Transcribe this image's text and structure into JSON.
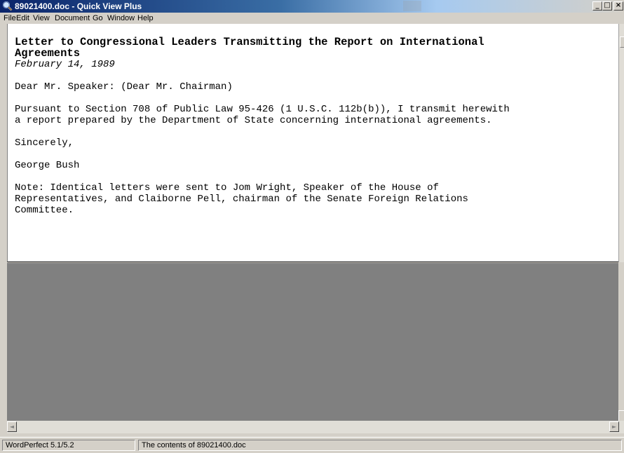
{
  "window": {
    "title": "89021400.doc - Quick View Plus",
    "app_icon": "magnifier-icon",
    "controls": {
      "minimize": "_",
      "maximize": "□",
      "close": "×"
    }
  },
  "menu": {
    "items": [
      "File",
      "Edit",
      "View",
      "Document",
      "Go",
      "Window",
      "Help"
    ]
  },
  "document": {
    "title_line1": "Letter to Congressional Leaders Transmitting the Report on International",
    "title_line2": "Agreements",
    "date": "February 14, 1989",
    "salutation": "Dear Mr. Speaker: (Dear Mr. Chairman)",
    "body_line1": "Pursuant to Section 708 of Public Law 95-426 (1 U.S.C. 112b(b)), I transmit herewith",
    "body_line2": "a report prepared by the Department of State concerning international agreements.",
    "closing": "Sincerely,",
    "signature": "George Bush",
    "note_line1": "Note: Identical letters were sent to Jom Wright, Speaker of the House of",
    "note_line2": "Representatives, and Claiborne Pell, chairman of the Senate Foreign Relations",
    "note_line3": "Committee."
  },
  "scrollbar": {
    "left_arrow": "◄",
    "right_arrow": "►"
  },
  "status": {
    "format": "WordPerfect 5.1/5.2",
    "message": "The contents of 89021400.doc"
  },
  "colors": {
    "titlebar_active": "#0a246a",
    "workspace": "#808080",
    "chrome": "#d4d0c8"
  }
}
